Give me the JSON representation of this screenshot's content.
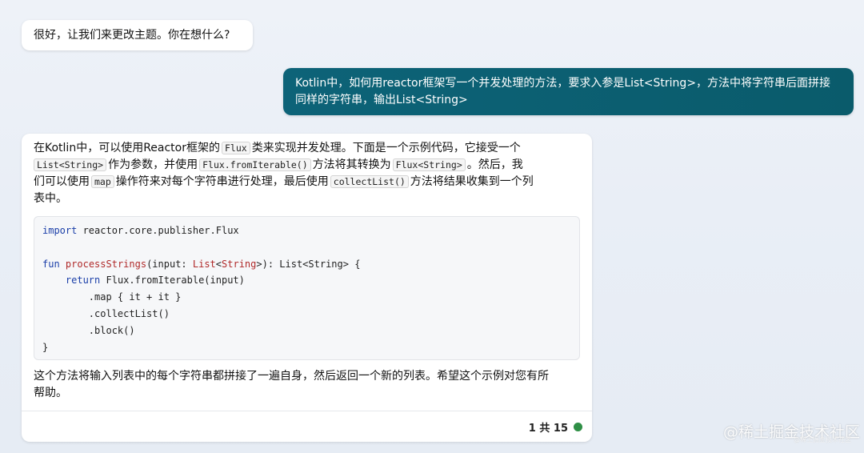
{
  "messages": {
    "bot_greeting": "很好，让我们来更改主题。你在想什么?",
    "user_question": {
      "line1": "Kotlin中，如何用reactor框架写一个并发处理的方法，要求入参是List<String>，方法中将字符串后面拼接",
      "line2": "同样的字符串，输出List<String>"
    },
    "bot_answer": {
      "intro": {
        "l1_a": "在Kotlin中，可以使用Reactor框架的",
        "l1_code": "Flux",
        "l1_b": "类来实现并发处理。下面是一个示例代码，它接受一个",
        "l2_code1": "List<String>",
        "l2_a": "作为参数，并使用",
        "l2_code2": "Flux.fromIterable()",
        "l2_b": "方法将其转换为",
        "l2_code3": "Flux<String>",
        "l2_c": "。然后，我",
        "l3_a": "们可以使用",
        "l3_code1": "map",
        "l3_b": "操作符来对每个字符串进行处理，最后使用",
        "l3_code2": "collectList()",
        "l3_c": "方法将结果收集到一个列",
        "l4": "表中。"
      },
      "code": {
        "l1_kw": "import",
        "l1_rest": " reactor.core.publisher.Flux",
        "l3_kw": "fun",
        "l3_fn": "processStrings",
        "l3_a": "(input: ",
        "l3_ty1": "List",
        "l3_b": "<",
        "l3_ty2": "String",
        "l3_c": ">): List<String> {",
        "l4_kw": "return",
        "l4_rest": " Flux.fromIterable(input)",
        "l5": "        .map { it + it }",
        "l6": "        .collectList()",
        "l7": "        .block()",
        "l8": "}"
      },
      "outro": {
        "l1": "这个方法将输入列表中的每个字符串都拼接了一遍自身，然后返回一个新的列表。希望这个示例对您有所",
        "l2": "帮助。"
      },
      "footer": {
        "counter": "1 共 15"
      }
    }
  },
  "watermark": {
    "main": "@稀土掘金技术社区",
    "small": "@稀土掘金技术社区"
  },
  "colors": {
    "user_bubble": "#0a5c6e",
    "status_dot": "#2f8f46",
    "code_keyword": "#1a3ea8",
    "code_function": "#b02a2a"
  }
}
